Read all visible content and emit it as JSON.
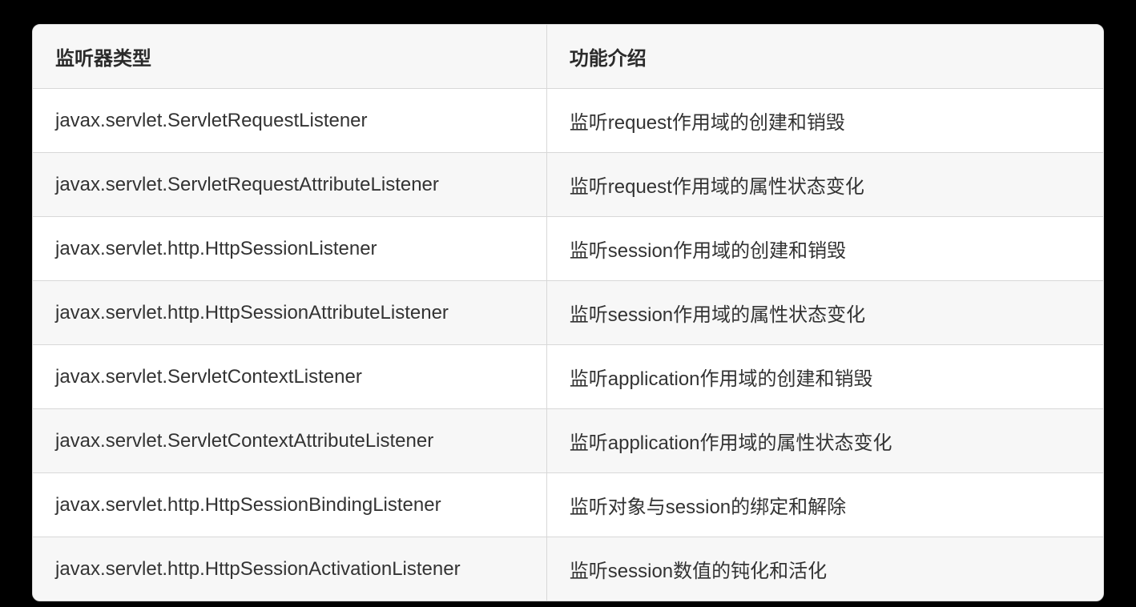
{
  "table": {
    "headers": {
      "type": "监听器类型",
      "desc": "功能介绍"
    },
    "rows": [
      {
        "type": "javax.servlet.ServletRequestListener",
        "desc": "监听request作用域的创建和销毁"
      },
      {
        "type": "javax.servlet.ServletRequestAttributeListener",
        "desc": "监听request作用域的属性状态变化"
      },
      {
        "type": "javax.servlet.http.HttpSessionListener",
        "desc": "监听session作用域的创建和销毁"
      },
      {
        "type": "javax.servlet.http.HttpSessionAttributeListener",
        "desc": "监听session作用域的属性状态变化"
      },
      {
        "type": "javax.servlet.ServletContextListener",
        "desc": "监听application作用域的创建和销毁"
      },
      {
        "type": "javax.servlet.ServletContextAttributeListener",
        "desc": "监听application作用域的属性状态变化"
      },
      {
        "type": "javax.servlet.http.HttpSessionBindingListener",
        "desc": "监听对象与session的绑定和解除"
      },
      {
        "type": "javax.servlet.http.HttpSessionActivationListener",
        "desc": "监听session数值的钝化和活化"
      }
    ]
  }
}
